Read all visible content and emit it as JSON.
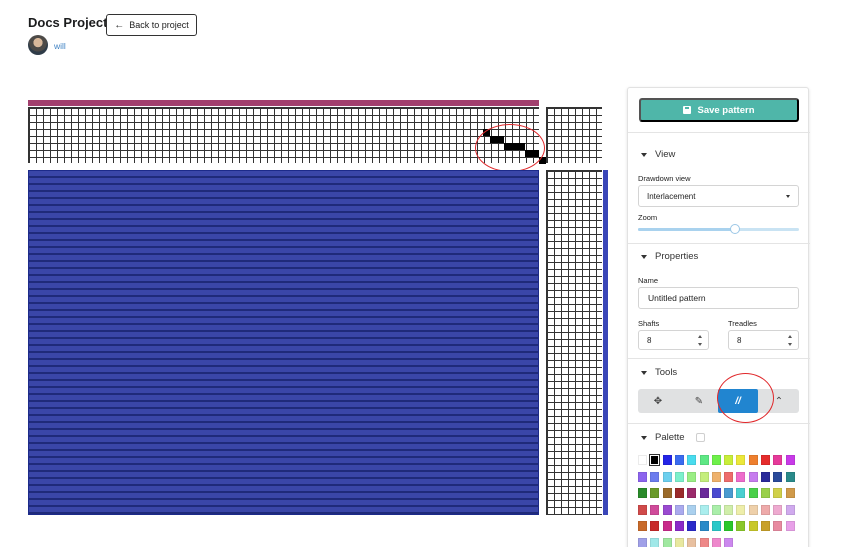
{
  "header": {
    "project_title": "Docs Project",
    "back_label": "Back to project",
    "username": "will"
  },
  "colors": {
    "tieup_bar": "#a13f6d",
    "drawdown_weft": "#3a46a8",
    "accent_save": "#4fb6a9",
    "active_tool": "#2185d0"
  },
  "sidebar": {
    "save_label": "Save pattern",
    "view": {
      "title": "View",
      "drawdown_label": "Drawdown view",
      "drawdown_value": "Interlacement",
      "zoom_label": "Zoom",
      "zoom_level": 0.6
    },
    "properties": {
      "title": "Properties",
      "name_label": "Name",
      "name_value": "Untitled pattern",
      "shafts_label": "Shafts",
      "shafts_value": "8",
      "treadles_label": "Treadles",
      "treadles_value": "8"
    },
    "tools": {
      "title": "Tools",
      "items": [
        {
          "name": "move-icon",
          "glyph": "✥"
        },
        {
          "name": "paint-brush-icon",
          "glyph": "✎"
        },
        {
          "name": "straight-draw-icon",
          "glyph": "//"
        },
        {
          "name": "chevron-up-icon",
          "glyph": "⌃"
        }
      ],
      "active_index": 2
    },
    "palette": {
      "title": "Palette",
      "colors": [
        "#ffffff",
        "#000000",
        "#2424e6",
        "#3a6cf0",
        "#49dcee",
        "#5ee885",
        "#6ef04a",
        "#c8ee3a",
        "#ece83a",
        "#ee7f2e",
        "#e52c2c",
        "#e63a9a",
        "#c83ae8",
        "#8c64ee",
        "#6c7cee",
        "#6ccfee",
        "#7cf0cc",
        "#9aee84",
        "#c4ee7c",
        "#eeb16c",
        "#ee6c6c",
        "#ee6ccc",
        "#c67cee",
        "#2a2a9a",
        "#2a4a9a",
        "#2a8a8a",
        "#2a8a2a",
        "#6a9a2a",
        "#9a6a2a",
        "#9a2a2a",
        "#9a2a6a",
        "#6a2a9a",
        "#4a4ad0",
        "#4a9ad0",
        "#4ad0d0",
        "#4ad04a",
        "#9ad04a",
        "#d0d04a",
        "#d09a4a",
        "#d04a4a",
        "#d04a9a",
        "#9a4ad0",
        "#aaaaee",
        "#aad0ee",
        "#aaeeee",
        "#aaeeaa",
        "#d0eeaa",
        "#eeeeaa",
        "#eed0aa",
        "#eeaaaa",
        "#eeaad0",
        "#d0aaee",
        "#c86a2a",
        "#c82a2a",
        "#c82a8a",
        "#8a2ac8",
        "#2a2ac8",
        "#2a8ac8",
        "#2ac8c8",
        "#2ac82a",
        "#8ac82a",
        "#c8c82a",
        "#c8a02a",
        "#e88aa0",
        "#e8a0e8",
        "#a0a0e8",
        "#a0e8e8",
        "#a0e8a0",
        "#e8e8a0",
        "#e8c0a0",
        "#ee8888",
        "#ee88cc",
        "#cc88ee"
      ]
    }
  }
}
